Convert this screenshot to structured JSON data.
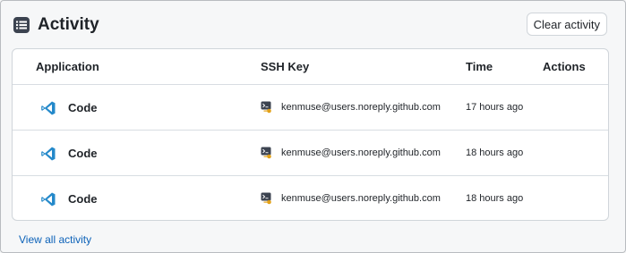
{
  "header": {
    "title": "Activity",
    "clear_button": "Clear activity",
    "icon": "list-icon"
  },
  "table": {
    "columns": [
      "Application",
      "SSH Key",
      "Time",
      "Actions"
    ],
    "rows": [
      {
        "app": "Code",
        "app_icon": "vscode-icon",
        "key": "kenmuse@users.noreply.github.com",
        "key_icon": "terminal-key-icon",
        "time": "17 hours ago"
      },
      {
        "app": "Code",
        "app_icon": "vscode-icon",
        "key": "kenmuse@users.noreply.github.com",
        "key_icon": "terminal-key-icon",
        "time": "18 hours ago"
      },
      {
        "app": "Code",
        "app_icon": "vscode-icon",
        "key": "kenmuse@users.noreply.github.com",
        "key_icon": "terminal-key-icon",
        "time": "18 hours ago"
      }
    ]
  },
  "footer": {
    "view_all_link": "View all activity"
  },
  "colors": {
    "link": "#0b61b8",
    "vscode_blue": "#2489ca",
    "border": "#d0d5da"
  }
}
